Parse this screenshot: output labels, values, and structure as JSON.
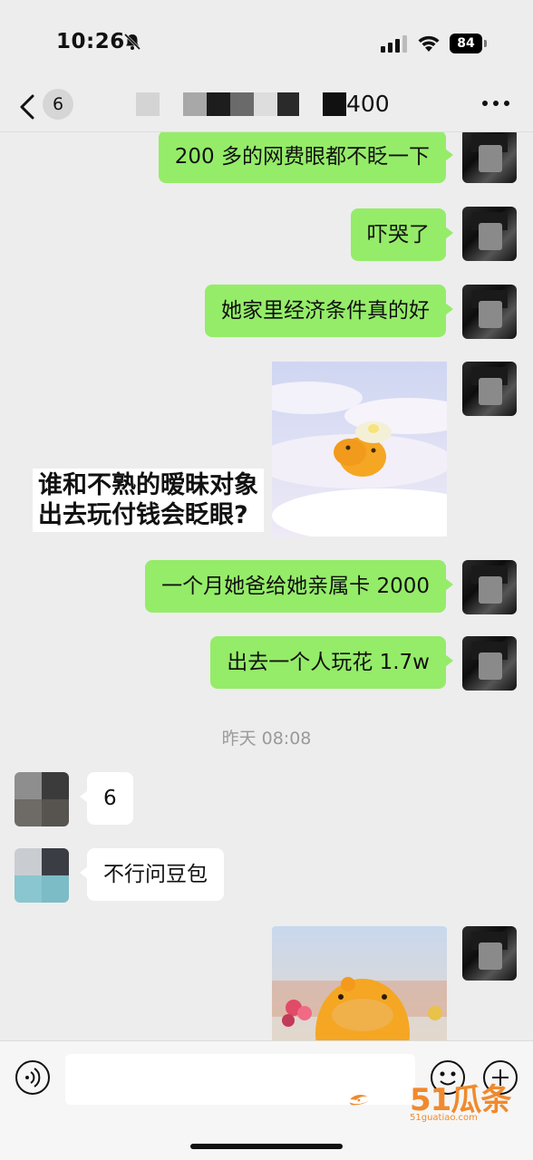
{
  "status_bar": {
    "time": "10:26",
    "battery": "84"
  },
  "nav": {
    "unread_count": "6",
    "title_suffix": "400"
  },
  "messages": [
    {
      "side": "me",
      "text": "200 多的网费眼都不眨一下"
    },
    {
      "side": "me",
      "text": "吓哭了"
    },
    {
      "side": "me",
      "text": "她家里经济条件真的好"
    },
    {
      "side": "me",
      "type": "image",
      "caption_line1": "谁和不熟的暧昧对象",
      "caption_line2": "出去玩付钱会眨眼?"
    },
    {
      "side": "me",
      "text": "一个月她爸给她亲属卡 2000"
    },
    {
      "side": "me",
      "text": "出去一个人玩花 1.7w"
    },
    {
      "type": "timestamp",
      "text": "昨天 08:08"
    },
    {
      "side": "other",
      "text": "6"
    },
    {
      "side": "other",
      "text": "不行问豆包"
    },
    {
      "side": "me",
      "type": "image"
    }
  ],
  "input": {
    "placeholder": ""
  },
  "watermark": {
    "text": "51瓜条",
    "sub": "51guatiao.com"
  },
  "colors": {
    "my_bubble": "#95ec69",
    "their_bubble": "#ffffff",
    "background": "#ededed"
  }
}
